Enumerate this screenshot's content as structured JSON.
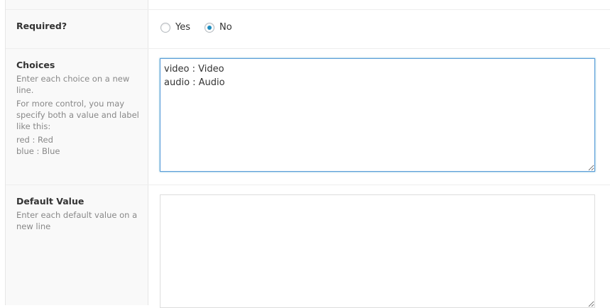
{
  "required": {
    "label": "Required?",
    "options": [
      "Yes",
      "No"
    ],
    "selected": "No"
  },
  "choices": {
    "label": "Choices",
    "desc_1": "Enter each choice on a new line.",
    "desc_2": "For more control, you may specify both a value and label like this:",
    "example_1": "red : Red",
    "example_2": "blue : Blue",
    "value": "video : Video\naudio : Audio"
  },
  "default_value": {
    "label": "Default Value",
    "desc": "Enter each default value on a new line",
    "value": ""
  }
}
